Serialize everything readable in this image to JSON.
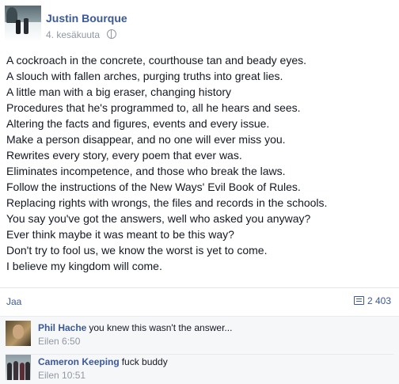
{
  "post": {
    "author": "Justin Bourque",
    "date": "4. kesäkuuta",
    "lines": [
      "A cockroach in the concrete, courthouse tan and beady eyes.",
      "A slouch with fallen arches, purging truths into great lies.",
      "A little man with a big eraser, changing history",
      "Procedures that he's programmed to, all he hears and sees.",
      "Altering the facts and figures, events and every issue.",
      "Make a person disappear, and no one will ever miss you.",
      "Rewrites every story, every poem that ever was.",
      "Eliminates incompetence, and those who break the laws.",
      "Follow the instructions of the New Ways' Evil Book of Rules.",
      "Replacing rights with wrongs, the files and records in the schools.",
      "You say you've got the answers, well who asked you anyway?",
      "Ever think maybe it was meant to be this way?",
      "Don't try to fool us, we know the worst is yet to come.",
      "I believe my kingdom will come."
    ]
  },
  "footer": {
    "share_label": "Jaa",
    "comment_count": "2 403"
  },
  "comments": [
    {
      "author": "Phil Hache",
      "text": "you knew this wasn't the answer...",
      "time": "Eilen 6:50"
    },
    {
      "author": "Cameron Keeping",
      "text": "fuck buddy",
      "time": "Eilen 10:51"
    }
  ],
  "colors": {
    "link": "#3b5998",
    "muted": "#9197a3",
    "text": "#141823",
    "comment_bg": "#f6f7f8"
  }
}
